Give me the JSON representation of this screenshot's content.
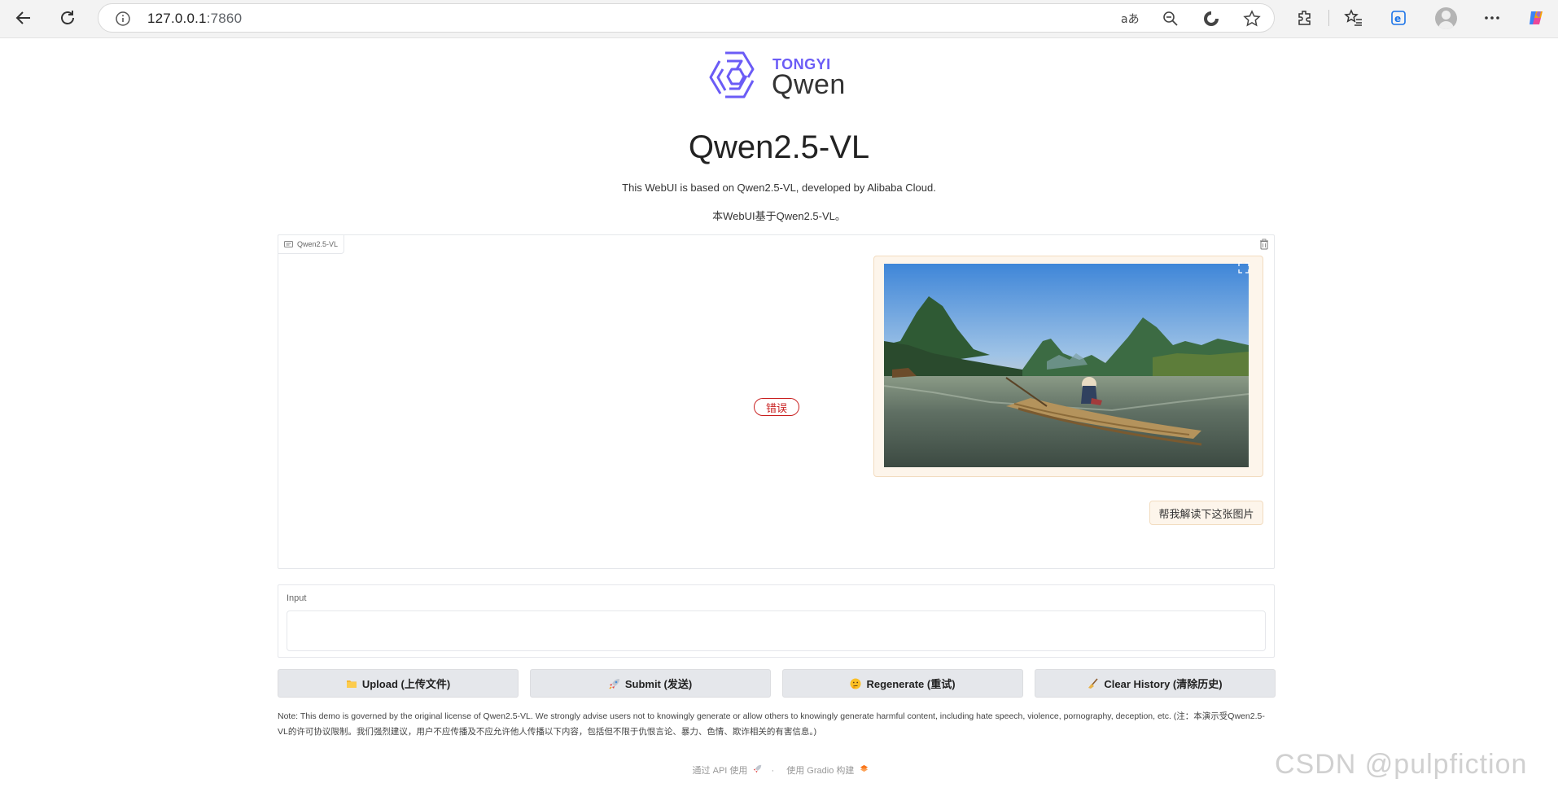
{
  "browser": {
    "url_host": "127.0.0.1",
    "url_port": ":7860"
  },
  "logo": {
    "brand_top": "TONGYI",
    "brand_name": "Qwen"
  },
  "header": {
    "title": "Qwen2.5-VL",
    "subtitle_en": "This WebUI is based on Qwen2.5-VL, developed by Alibaba Cloud.",
    "subtitle_zh": "本WebUI基于Qwen2.5-VL。"
  },
  "chatbot": {
    "label": "Qwen2.5-VL",
    "error_badge": "错误",
    "user_message": "帮我解读下这张图片"
  },
  "input": {
    "label": "Input",
    "value": ""
  },
  "buttons": {
    "upload": "Upload (上传文件)",
    "submit": "Submit (发送)",
    "regenerate": "Regenerate (重试)",
    "clear": "Clear History (清除历史)"
  },
  "note": "Note: This demo is governed by the original license of Qwen2.5-VL. We strongly advise users not to knowingly generate or allow others to knowingly generate harmful content, including hate speech, violence, pornography, deception, etc. (注：本演示受Qwen2.5-VL的许可协议限制。我们强烈建议，用户不应传播及不应允许他人传播以下内容，包括但不限于仇恨言论、暴力、色情、欺诈相关的有害信息。)",
  "footer": {
    "api": "通过 API 使用",
    "separator": "·",
    "gradio": "使用 Gradio 构建"
  },
  "watermark": "CSDN @pulpfiction",
  "colors": {
    "accent": "#6b5cf6",
    "error": "#c81e1e",
    "bubble_bg": "#fdf5eb"
  }
}
